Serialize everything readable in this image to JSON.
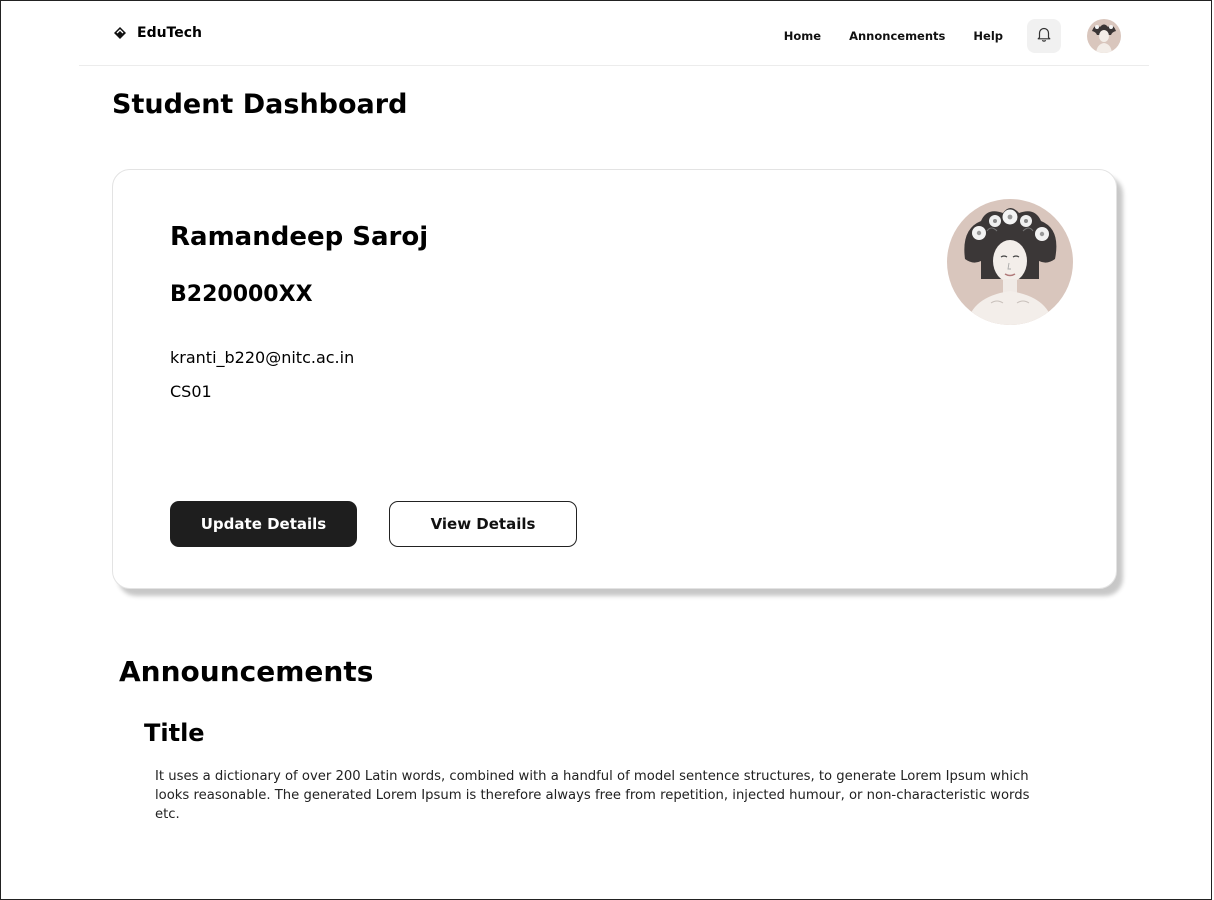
{
  "nav": {
    "brand": "EduTech",
    "links": [
      "Home",
      "Annoncements",
      "Help"
    ]
  },
  "page": {
    "title": "Student Dashboard"
  },
  "profile": {
    "name": "Ramandeep Saroj",
    "roll_no": "B220000XX",
    "email": "kranti_b220@nitc.ac.in",
    "batch": "CS01",
    "update_button": "Update Details",
    "view_button": "View Details"
  },
  "announcements": {
    "heading": "Announcements",
    "items": [
      {
        "title": "Title",
        "body": "It uses a dictionary of over 200 Latin words, combined with a handful of model sentence structures, to generate Lorem Ipsum which looks reasonable. The generated Lorem Ipsum is therefore always free from repetition, injected humour, or non-characteristic words etc."
      }
    ]
  },
  "icons": {
    "brand": "diamond-logo-icon",
    "notifications": "bell-icon"
  },
  "colors": {
    "primary_button": "#1e1e1e",
    "avatar_bg": "#d9c6bd"
  }
}
